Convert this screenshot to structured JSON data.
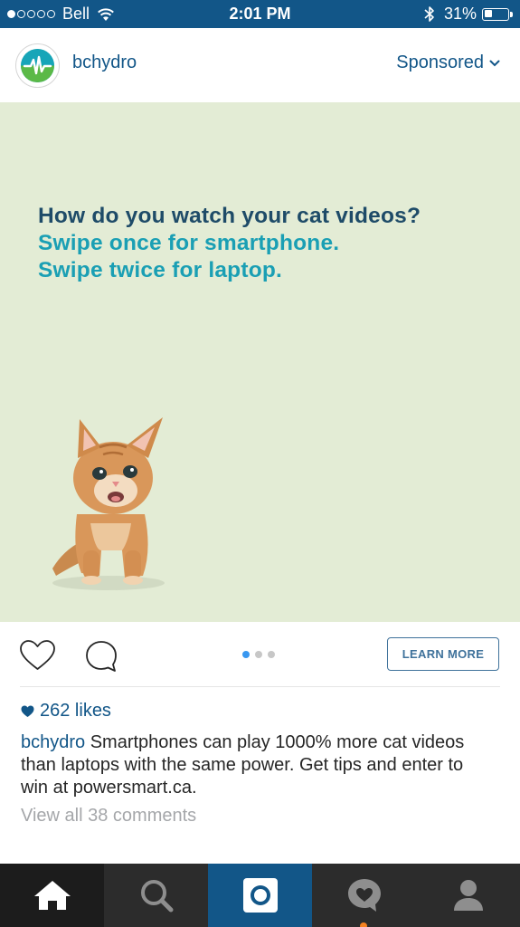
{
  "status_bar": {
    "carrier": "Bell",
    "time": "2:01 PM",
    "battery_percent": "31%",
    "signal_bars_filled": 1,
    "signal_bars_total": 5,
    "battery_level": 0.31
  },
  "post": {
    "username": "bchydro",
    "sponsored_label": "Sponsored",
    "ad": {
      "line1": "How do you watch your cat videos?",
      "line2": "Swipe once for smartphone.",
      "line3": "Swipe twice for laptop."
    },
    "carousel": {
      "count": 3,
      "active_index": 0
    },
    "learn_more_label": "LEARN MORE",
    "likes": "262 likes",
    "caption_user": "bchydro",
    "caption_text": " Smartphones can play 1000% more cat videos than laptops with the same power. Get tips and enter to win at powersmart.ca.",
    "view_comments": "View all 38 comments"
  },
  "tabs": [
    "home-icon",
    "search-icon",
    "camera-icon",
    "activity-icon",
    "profile-icon"
  ],
  "colors": {
    "brand": "#125688",
    "ad_background": "#e3ecd5",
    "ad_heading": "#1e4b68",
    "ad_accent": "#1a9fb4",
    "notification": "#f58220"
  }
}
